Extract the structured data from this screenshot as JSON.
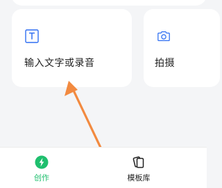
{
  "cards": [
    {
      "label": "输入文字或录音",
      "icon": "text-box-icon"
    },
    {
      "label": "拍摄",
      "icon": "camera-icon"
    }
  ],
  "tabs": [
    {
      "label": "创作",
      "icon": "create-bolt-icon",
      "active": true
    },
    {
      "label": "模板库",
      "icon": "template-cards-icon",
      "active": false
    }
  ],
  "annotation": {
    "icon": "pointer-arrow-icon"
  },
  "colors": {
    "accent": "#1fbf6e",
    "icon_blue": "#2f6ff2",
    "arrow": "#f28a40",
    "text": "#1f1f1f",
    "background": "#f4f5f7"
  }
}
